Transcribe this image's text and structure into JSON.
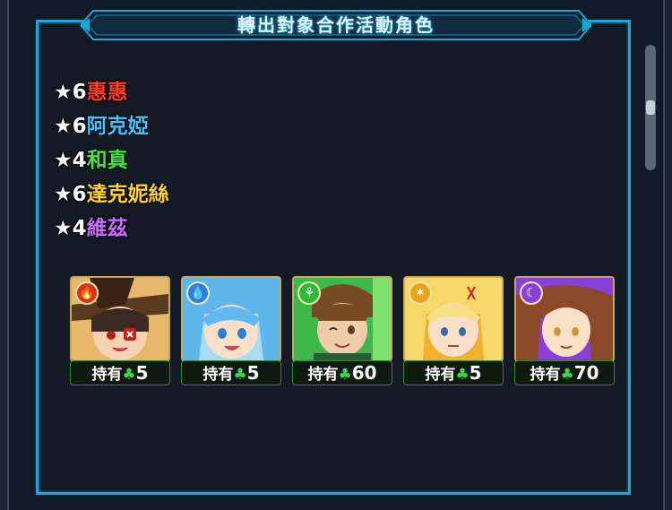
{
  "banner": {
    "title": "轉出對象合作活動角色"
  },
  "characters": [
    {
      "rarity": "★6",
      "name": "惠惠",
      "color": "#ff3b22"
    },
    {
      "rarity": "★6",
      "name": "阿克婭",
      "color": "#3fc4ff"
    },
    {
      "rarity": "★4",
      "name": "和真",
      "color": "#46e046"
    },
    {
      "rarity": "★6",
      "name": "達克妮絲",
      "color": "#ffd21e"
    },
    {
      "rarity": "★4",
      "name": "維茲",
      "color": "#cc6cff"
    }
  ],
  "cards": [
    {
      "owned_label": "持有",
      "clover_icon": "clover-icon",
      "count": "5",
      "element": "fire",
      "element_color": "#d8321e"
    },
    {
      "owned_label": "持有",
      "clover_icon": "clover-icon",
      "count": "5",
      "element": "water",
      "element_color": "#2a7fe0"
    },
    {
      "owned_label": "持有",
      "clover_icon": "clover-icon",
      "count": "60",
      "element": "wood",
      "element_color": "#2fb83a"
    },
    {
      "owned_label": "持有",
      "clover_icon": "clover-icon",
      "count": "5",
      "element": "light",
      "element_color": "#e8a41a"
    },
    {
      "owned_label": "持有",
      "clover_icon": "clover-icon",
      "count": "70",
      "element": "dark",
      "element_color": "#8a3fd8"
    }
  ]
}
